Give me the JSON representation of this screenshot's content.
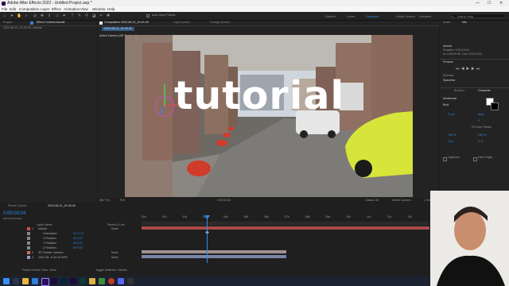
{
  "title_bar": {
    "title": "Adobe After Effects 2022 - Untitled Project.aep *"
  },
  "menu": [
    "File",
    "Edit",
    "Composition",
    "Layer",
    "Effect",
    "Animation",
    "View",
    "Window",
    "Help"
  ],
  "toolbar": {
    "tools": [
      "home",
      "selection",
      "hand",
      "zoom",
      "orbit",
      "pan",
      "dolly",
      "rectangle",
      "pen",
      "type",
      "brush",
      "clone",
      "eraser",
      "roto",
      "puppet"
    ],
    "snap_label": "Auto-Open Panels",
    "workspaces": [
      "Default",
      "Learn",
      "Standard",
      "Small Screen",
      "Libraries"
    ],
    "active_workspace": "Standard",
    "search_placeholder": "Search Help"
  },
  "project_panel": {
    "tab": "Project",
    "effect_tab": "Effect Controls tutorial",
    "subtitle": "2022-08-12_19-49-40 • tutorial"
  },
  "composition_panel": {
    "tab_label": "Composition 2022-08-12_19-49-40",
    "layer_tab": "Layer (none)",
    "footage_tab": "Footage (none)",
    "breadcrumb": "2022-08-12_19-49-40",
    "camera_label": "Active Camera (3D Tracker Camera)",
    "overlay_text": "tutorial"
  },
  "viewer_footer": {
    "zoom": "(56,7%)",
    "resolution": "Full",
    "timecode": "0:00:03:04",
    "renderer": "Classic 3D",
    "view": "Active Camera",
    "views": "1 View"
  },
  "right_panels": {
    "audio_tab": "Audio",
    "info_tab": "Info",
    "info_text": [
      "tutorial",
      "Duration: 0:00:14:04",
      "In: 0:00:00:00, Out: 0:00:14:03"
    ],
    "preview_title": "Preview",
    "shortcut_label": "Shortcut",
    "shortcut_value": "Spacebar",
    "brushes_tab": "Brushes",
    "character_tab": "Character",
    "font": "Montserrat",
    "font_style": "Bold",
    "size": "71 px",
    "leading": "Auto",
    "tracking": "0",
    "stroke": "Fill Over Stroke",
    "scale_v": "100 %",
    "scale_h": "100 %",
    "baseline": "0 px",
    "tsume": "0 %",
    "ligatures": "Ligatures",
    "hindi": "Hindi Digits"
  },
  "timeline": {
    "render_tab": "Render Queue",
    "comp_tab": "2022-08-12_19-49-40",
    "current_time": "0:00:03:04",
    "frame_sub": "00076 (24.00 fps)",
    "col_layer": "Layer Name",
    "col_parent": "Parent & Link",
    "ruler": [
      "00s",
      "01s",
      "02s",
      "03s",
      "04s",
      "05s",
      "06s",
      "07s",
      "08s",
      "09s",
      "10s",
      "11s",
      "12s",
      "13s"
    ],
    "layers": [
      {
        "index": "1",
        "name": "tutorial",
        "parent": "None",
        "color": "#d45050"
      },
      {
        "index": "",
        "name": "Orientation",
        "value": "0,0°,0,0°",
        "color": "#888888"
      },
      {
        "index": "",
        "name": "X Rotation",
        "value": "0x+0,0°",
        "color": "#888888"
      },
      {
        "index": "",
        "name": "Y Rotation",
        "value": "0x+0,0°",
        "color": "#888888"
      },
      {
        "index": "",
        "name": "Z Rotation",
        "value": "0x+0,0°",
        "color": "#888888"
      },
      {
        "index": "2",
        "name": "3D Tracker Camera",
        "parent": "None",
        "color": "#d06a6a"
      },
      {
        "index": "3",
        "name": "2022-08...9-49-40.MP4",
        "parent": "None",
        "color": "#8fa0c9"
      }
    ],
    "footer": "Frame Render Time: 12ms",
    "toggle_label": "Toggle Switches / Modes"
  },
  "taskbar": {
    "apps": [
      "start",
      "search",
      "explorer",
      "edge",
      "ae",
      "pr",
      "ps",
      "me",
      "au",
      "folder",
      "chrome",
      "record",
      "discord",
      "obs"
    ]
  }
}
